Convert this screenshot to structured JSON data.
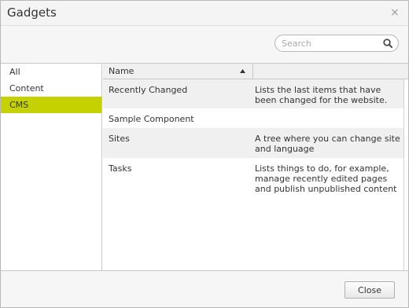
{
  "dialog": {
    "title": "Gadgets",
    "close_glyph": "×"
  },
  "search": {
    "placeholder": "Search",
    "value": ""
  },
  "sidebar": {
    "items": [
      {
        "label": "All",
        "selected": false
      },
      {
        "label": "Content",
        "selected": false
      },
      {
        "label": "CMS",
        "selected": true
      }
    ],
    "selected_color": "#c5d100"
  },
  "grid": {
    "columns": [
      {
        "label": "Name",
        "sort": "ascending"
      },
      {
        "label": ""
      }
    ],
    "rows": [
      {
        "name": "Recently Changed",
        "description": "Lists the last items that have been changed for the website."
      },
      {
        "name": "Sample Component",
        "description": ""
      },
      {
        "name": "Sites",
        "description": "A tree where you can change site and language"
      },
      {
        "name": "Tasks",
        "description": "Lists things to do, for example, manage recently edited pages and publish unpublished content"
      }
    ]
  },
  "footer": {
    "close_label": "Close"
  },
  "icons": {
    "search": "search-icon",
    "close": "close-icon",
    "sort": "sort-ascending-icon"
  }
}
